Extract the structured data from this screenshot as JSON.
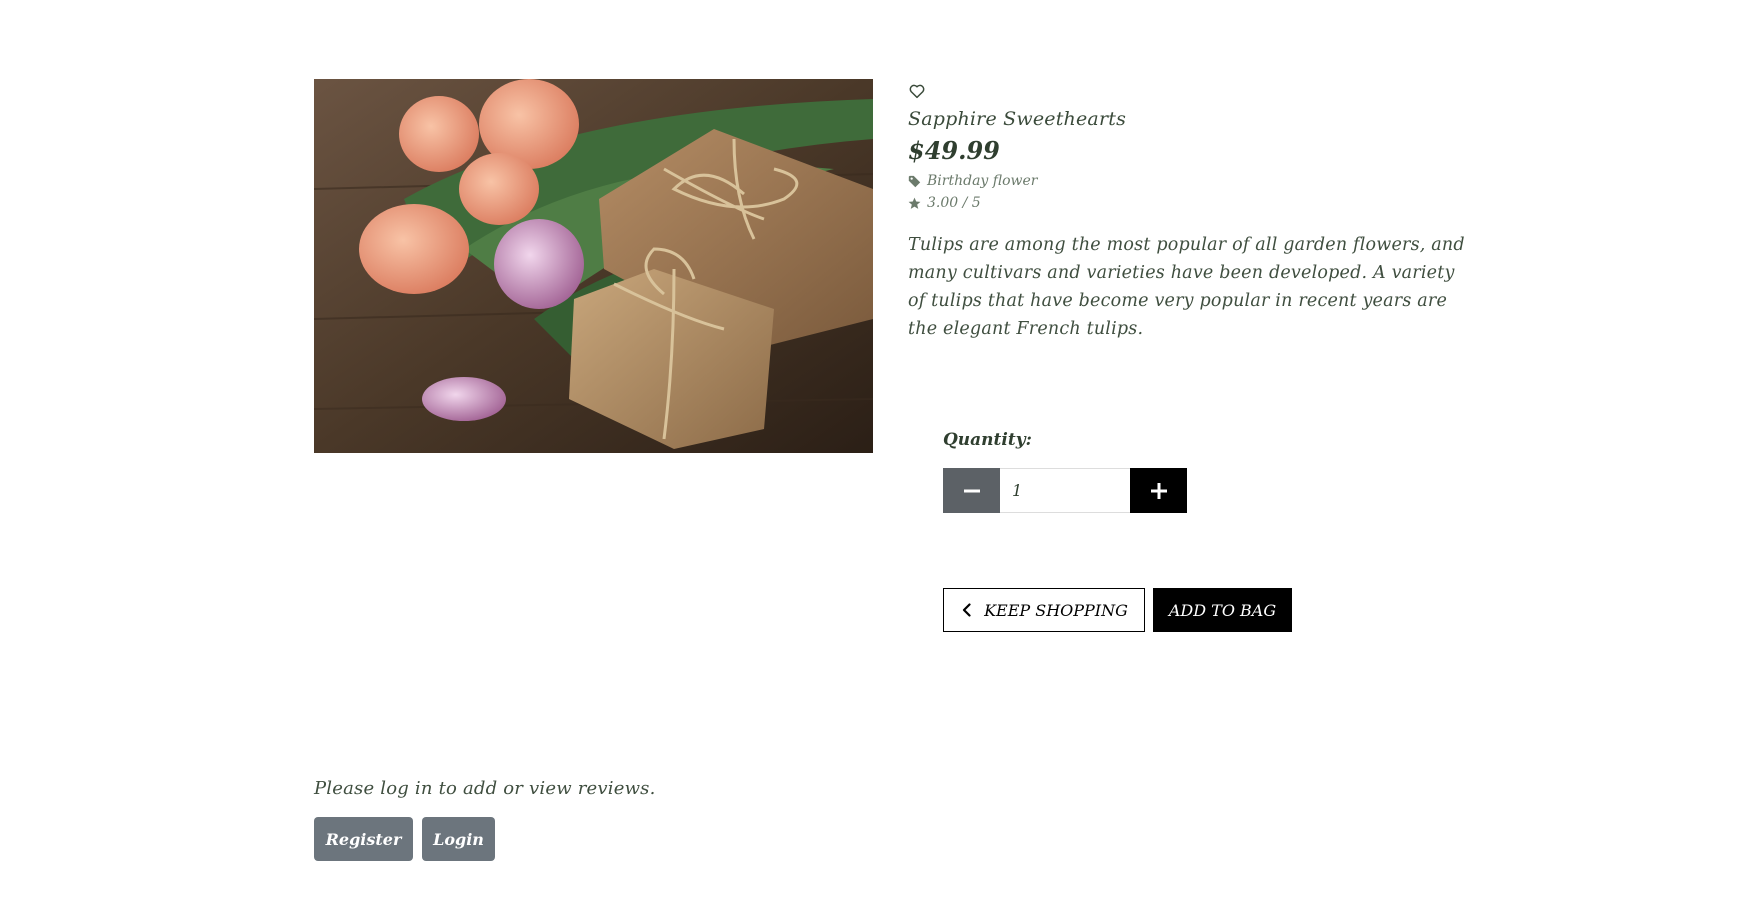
{
  "product": {
    "name": "Sapphire Sweethearts",
    "price": "$49.99",
    "category": "Birthday flower",
    "rating": "3.00 / 5",
    "description": "Tulips are among the most popular of all garden flowers, and many cultivars and varieties have been developed. A variety of tulips that have become very popular in recent years are the elegant French tulips.",
    "image_icon": "product-photo-tulips-gift-boxes"
  },
  "icons": {
    "wishlist": "heart-outline-icon",
    "category": "tag-icon",
    "rating": "star-icon",
    "minus": "minus-icon",
    "plus": "plus-icon",
    "back": "chevron-left-icon"
  },
  "quantity": {
    "label": "Quantity:",
    "value": "1"
  },
  "actions": {
    "keep_shopping": "KEEP SHOPPING",
    "add_to_bag": "ADD TO BAG"
  },
  "reviews": {
    "message": "Please log in to add or view reviews.",
    "register_label": "Register",
    "login_label": "Login"
  },
  "colors": {
    "text": "#2f3e2f",
    "muted": "#6b7a6b",
    "secondary_button": "#6c757d",
    "minus_button": "#5c6166",
    "primary_button": "#000000"
  }
}
